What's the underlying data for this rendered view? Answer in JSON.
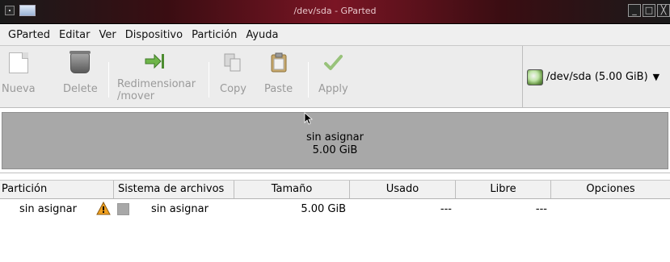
{
  "window": {
    "title": "/dev/sda - GParted",
    "controls": [
      "minimize-icon",
      "maximize-icon",
      "close-icon"
    ]
  },
  "menubar": {
    "items": [
      {
        "label": "GParted"
      },
      {
        "label": "Editar"
      },
      {
        "label": "Ver"
      },
      {
        "label": "Dispositivo"
      },
      {
        "label": "Partición"
      },
      {
        "label": "Ayuda"
      }
    ]
  },
  "toolbar": {
    "new_label": "Nueva",
    "delete_label": "Delete",
    "resize_label": "Redimensionar\n/mover",
    "copy_label": "Copy",
    "paste_label": "Paste",
    "apply_label": "Apply"
  },
  "device": {
    "label": "/dev/sda  (5.00 GiB)",
    "icon": "disk-icon"
  },
  "visual": {
    "name": "sin asignar",
    "size": "5.00 GiB",
    "color": "#a8a8a8"
  },
  "table": {
    "columns": [
      {
        "label": "Partición"
      },
      {
        "label": "Sistema de archivos"
      },
      {
        "label": "Tamaño"
      },
      {
        "label": "Usado"
      },
      {
        "label": "Libre"
      },
      {
        "label": "Opciones"
      }
    ],
    "rows": [
      {
        "partition": "sin asignar",
        "filesystem": "sin asignar",
        "size": "5.00 GiB",
        "used": "---",
        "free": "---",
        "options": ""
      }
    ]
  },
  "colors": {
    "titlebar_accent": "#7a1524",
    "unallocated": "#a8a8a8",
    "warning": "#f0a020"
  }
}
